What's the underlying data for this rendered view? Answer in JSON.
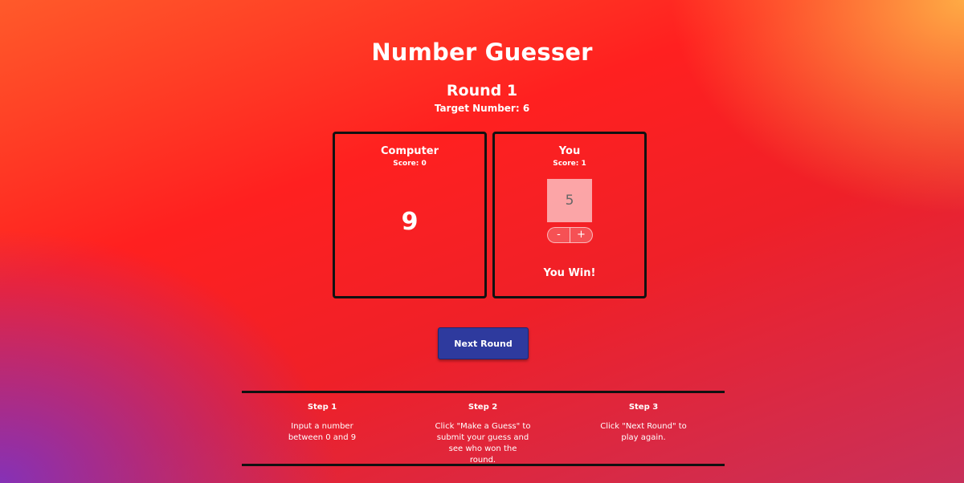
{
  "app": {
    "title": "Number Guesser"
  },
  "round": {
    "label": "Round 1",
    "target_label": "Target Number: 6"
  },
  "computer": {
    "name": "Computer",
    "score_label": "Score: 0",
    "guess": "9"
  },
  "player": {
    "name": "You",
    "score_label": "Score: 1",
    "guess_value": "5",
    "decrement_label": "-",
    "increment_label": "+",
    "result": "You Win!"
  },
  "actions": {
    "next_round_label": "Next Round"
  },
  "steps": [
    {
      "title": "Step 1",
      "text": "Input a number between 0 and 9"
    },
    {
      "title": "Step 2",
      "text": "Click \"Make a Guess\" to submit your guess and see who won the round."
    },
    {
      "title": "Step 3",
      "text": "Click \"Next Round\" to play again."
    }
  ],
  "colors": {
    "button_bg": "#2e3a9e",
    "border": "#111111",
    "background_main": "#ff2020",
    "background_corner_top_right": "#ffb246",
    "background_corner_bottom_left": "#8032be"
  }
}
